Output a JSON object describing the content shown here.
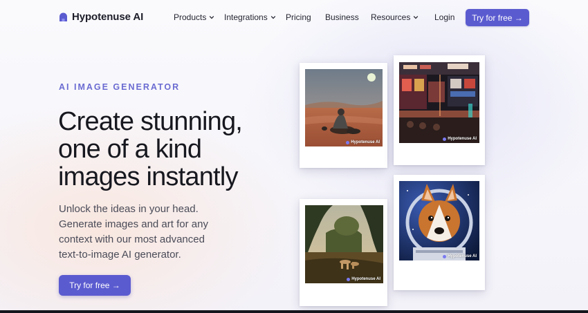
{
  "nav": {
    "brand": "Hypotenuse AI",
    "items": [
      {
        "label": "Products",
        "dropdown": true
      },
      {
        "label": "Integrations",
        "dropdown": true
      },
      {
        "label": "Pricing",
        "dropdown": false
      },
      {
        "label": "Business",
        "dropdown": false
      },
      {
        "label": "Resources",
        "dropdown": true
      }
    ],
    "login": "Login",
    "cta": "Try for free →"
  },
  "hero": {
    "eyebrow": "AI IMAGE GENERATOR",
    "headline": [
      "Create stunning,",
      "one of a kind",
      "images instantly"
    ],
    "subtitle": [
      "Unlock the ideas in your head.",
      "Generate images and art for any",
      "context with our most advanced",
      "text-to-image AI generator."
    ],
    "cta": "Try for free →"
  },
  "gallery": {
    "watermark": "Hypotenuse AI",
    "cards": [
      {
        "subject": "figure-in-desert-image"
      },
      {
        "subject": "neon-bar-interior-image"
      },
      {
        "subject": "forest-deer-painting-image"
      },
      {
        "subject": "corgi-astronaut-image"
      }
    ]
  },
  "colors": {
    "accent": "#5b5bd0",
    "eyebrow": "#6b6bd2",
    "text": "#17181f"
  }
}
